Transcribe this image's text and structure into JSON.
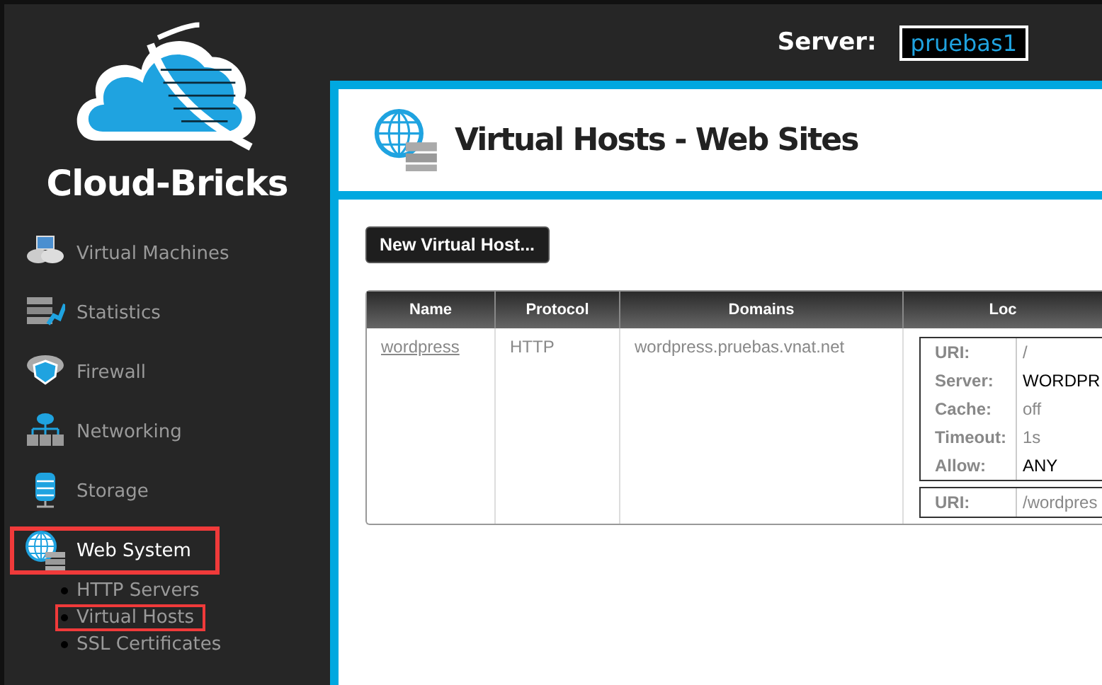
{
  "header": {
    "server_label": "Server:",
    "server_value": "pruebas1"
  },
  "logo": {
    "text": "Cloud-Bricks"
  },
  "sidebar": {
    "items": [
      {
        "label": "Virtual Machines",
        "selected": false
      },
      {
        "label": "Statistics",
        "selected": false
      },
      {
        "label": "Firewall",
        "selected": false
      },
      {
        "label": "Networking",
        "selected": false
      },
      {
        "label": "Storage",
        "selected": false
      },
      {
        "label": "Web System",
        "selected": true,
        "children": [
          {
            "label": "HTTP Servers",
            "selected": false
          },
          {
            "label": "Virtual Hosts",
            "selected": true
          },
          {
            "label": "SSL Certificates",
            "selected": false
          }
        ]
      }
    ]
  },
  "page": {
    "title": "Virtual Hosts - Web Sites",
    "new_button": "New Virtual Host..."
  },
  "table": {
    "columns": [
      "Name",
      "Protocol",
      "Domains",
      "Loc"
    ],
    "rows": [
      {
        "name": "wordpress",
        "protocol": "HTTP",
        "domains": "wordpress.pruebas.vnat.net",
        "locations": [
          {
            "fields": [
              {
                "label": "URI:",
                "value": "/",
                "emphasis": false
              },
              {
                "label": "Server:",
                "value": "WORDPR",
                "emphasis": true
              },
              {
                "label": "Cache:",
                "value": "off",
                "emphasis": false
              },
              {
                "label": "Timeout:",
                "value": "1s",
                "emphasis": false
              },
              {
                "label": "Allow:",
                "value": "ANY",
                "emphasis": true
              }
            ]
          },
          {
            "fields": [
              {
                "label": "URI:",
                "value": "/wordpres",
                "emphasis": false
              }
            ]
          }
        ]
      }
    ]
  }
}
